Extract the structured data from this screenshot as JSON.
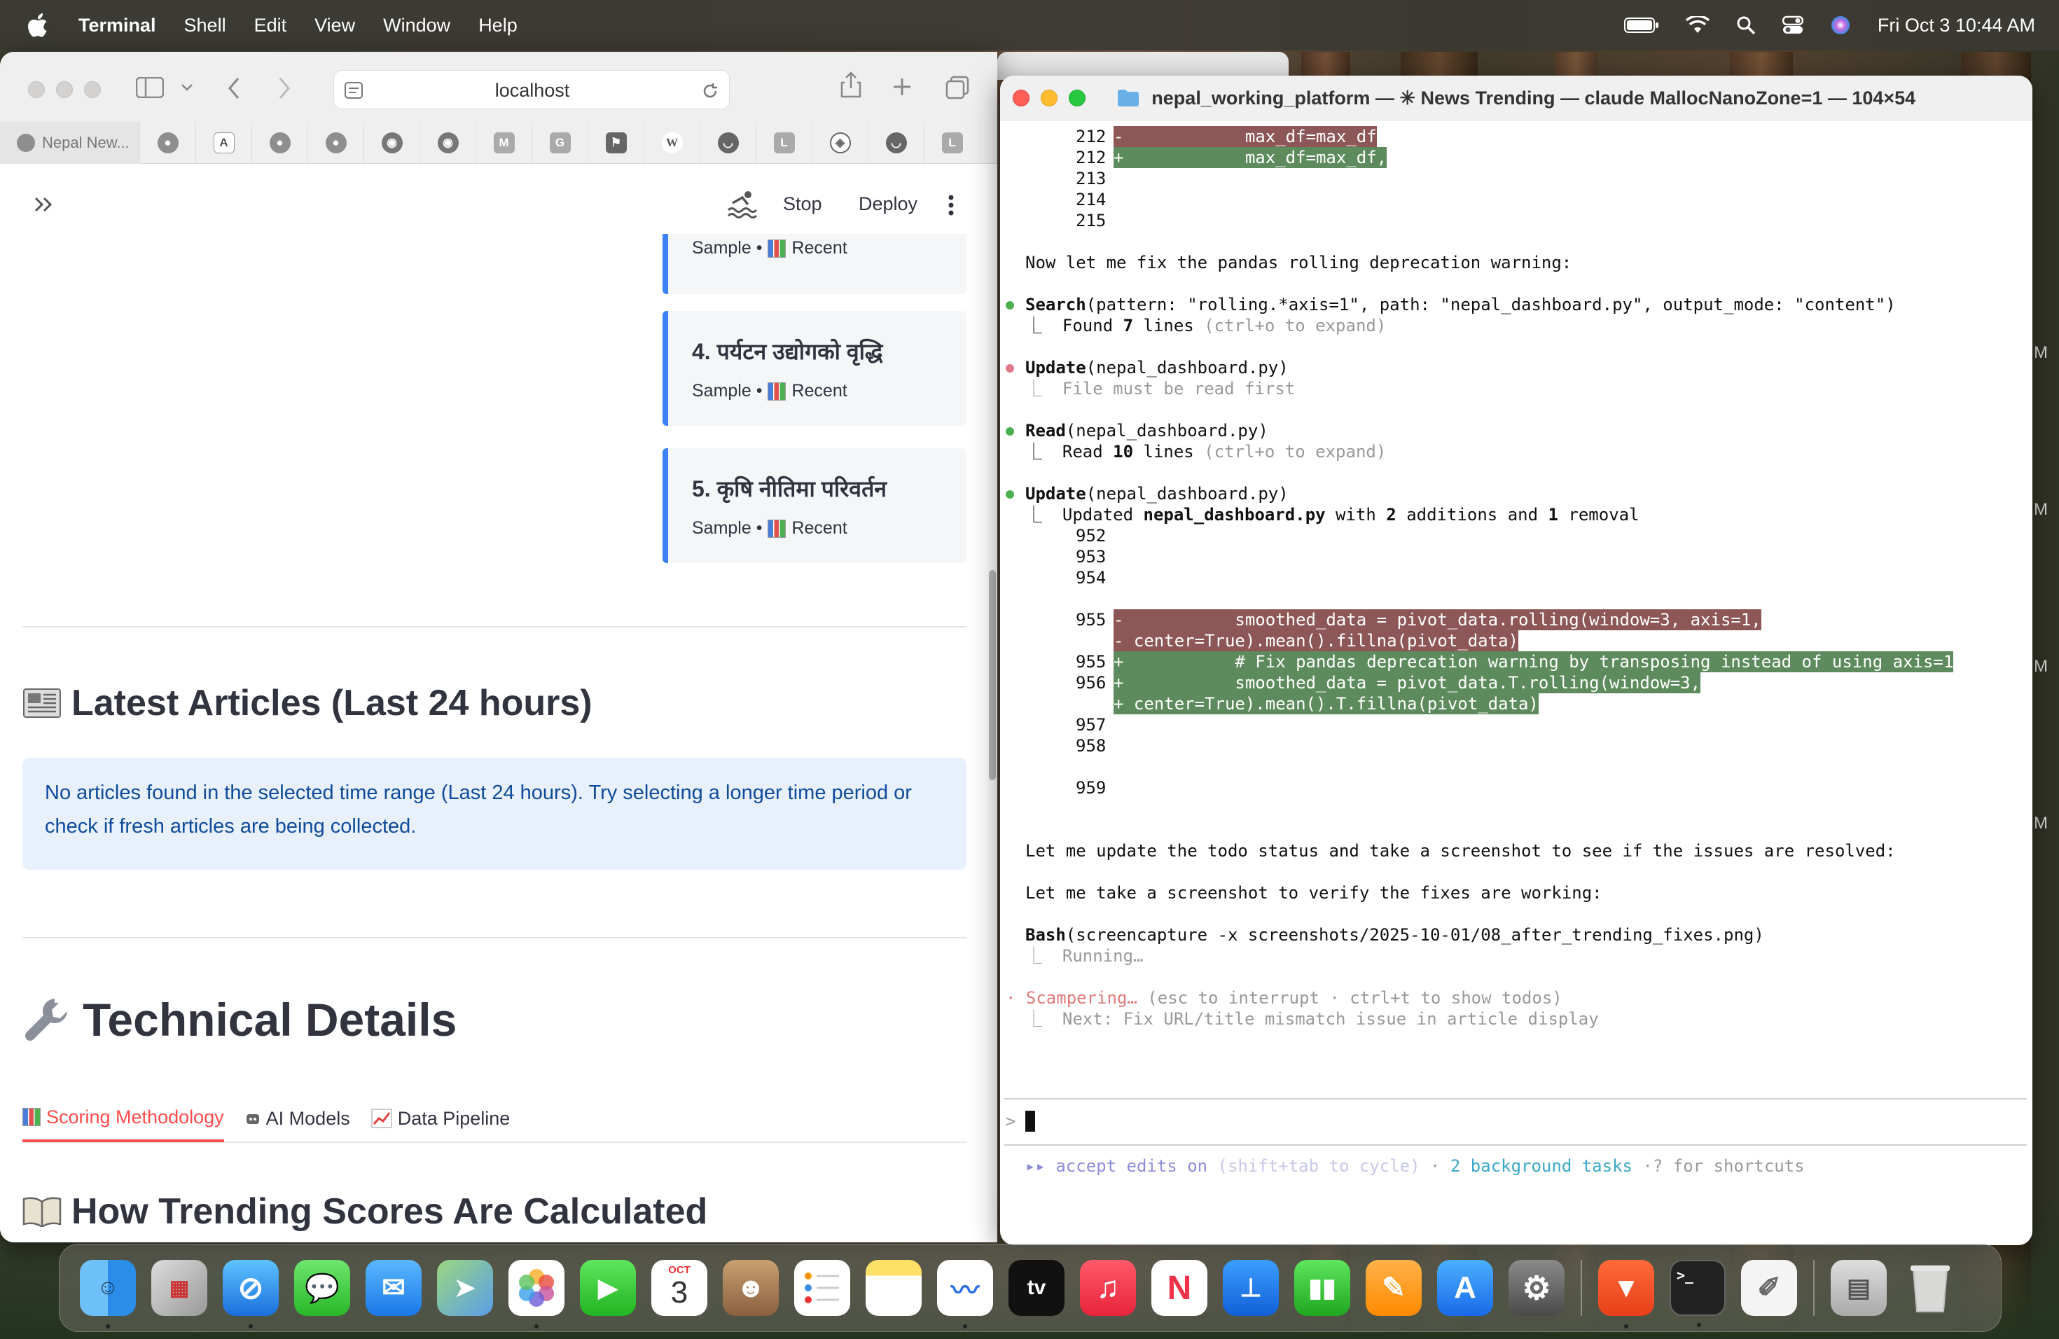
{
  "menubar": {
    "app_name": "Terminal",
    "items": [
      "Shell",
      "Edit",
      "View",
      "Window",
      "Help"
    ],
    "clock": "Fri Oct 3  10:44 AM"
  },
  "browser": {
    "url": "localhost",
    "active_tab": "Nepal New...",
    "tab_favicons": [
      "reddit-icon",
      "ai-icon",
      "reddit-icon",
      "reddit-icon",
      "github-icon",
      "github-icon",
      "M",
      "G",
      "flag-icon",
      "W",
      "pocket-icon",
      "L",
      "compass-icon",
      "pocket-icon",
      "L"
    ],
    "header": {
      "stop_label": "Stop",
      "deploy_label": "Deploy"
    },
    "cards": [
      {
        "title": "",
        "meta_prefix": "Sample •",
        "meta_suffix": "Recent"
      },
      {
        "title": "4. पर्यटन उद्योगको वृद्धि",
        "meta_prefix": "Sample •",
        "meta_suffix": "Recent"
      },
      {
        "title": "5. कृषि नीतिमा परिवर्तन",
        "meta_prefix": "Sample •",
        "meta_suffix": "Recent"
      }
    ],
    "latest_heading": "Latest Articles (Last 24 hours)",
    "info_text": "No articles found in the selected time range (Last 24 hours). Try selecting a longer time period or check if fresh articles are being collected.",
    "tech_heading": "Technical Details",
    "tabs": [
      "Scoring Methodology",
      "AI Models",
      "Data Pipeline"
    ],
    "how_heading": "How Trending Scores Are Calculated"
  },
  "terminal": {
    "title": "nepal_working_platform — ✳ News Trending — claude MallocNanoZone=1 — 104×54",
    "lines": {
      "l212a_num": "212",
      "l212a_code": "-            max_df=max_df",
      "l212b_num": "212",
      "l212b_code": "+            max_df=max_df,",
      "l213": "213",
      "l214": "214",
      "l215": "215",
      "msg1": "Now let me fix the pandas rolling deprecation warning:",
      "search_tool": "Search",
      "search_args": "(pattern: \"rolling.*axis=1\", path: \"nepal_dashboard.py\", output_mode: \"content\")",
      "search_res_a": "⎿  Found ",
      "search_res_n": "7",
      "search_res_b": " lines ",
      "search_res_hint": "(ctrl+o to expand)",
      "update1_tool": "Update",
      "update1_args": "(nepal_dashboard.py)",
      "update1_res": "⎿  File must be read first",
      "read_tool": "Read",
      "read_args": "(nepal_dashboard.py)",
      "read_res_a": "⎿  Read ",
      "read_res_n": "10",
      "read_res_b": " lines ",
      "read_res_hint": "(ctrl+o to expand)",
      "update2_tool": "Update",
      "update2_args": "(nepal_dashboard.py)",
      "update2_res_a": "⎿  Updated ",
      "update2_res_file": "nepal_dashboard.py",
      "update2_res_b": " with ",
      "update2_res_n1": "2",
      "update2_res_c": " additions and ",
      "update2_res_n2": "1",
      "update2_res_d": " removal",
      "n952": "952",
      "n953": "953",
      "n954": "954",
      "n955a": "955",
      "d955a": "-           smoothed_data = pivot_data.rolling(window=3, axis=1,",
      "d955b": "- center=True).mean().fillna(pivot_data)",
      "n955b": "955",
      "a955": "+           # Fix pandas deprecation warning by transposing instead of using axis=1",
      "n956": "956",
      "a956": "+           smoothed_data = pivot_data.T.rolling(window=3,",
      "a956b": "+ center=True).mean().T.fillna(pivot_data)",
      "n957": "957",
      "n958": "958",
      "n959": "959",
      "msg2": "Let me update the todo status and take a screenshot to see if the issues are resolved:",
      "msg3": "Let me take a screenshot to verify the fixes are working:",
      "bash_tool": "Bash",
      "bash_args": "(screencapture -x screenshots/2025-10-01/08_after_trending_fixes.png)",
      "bash_res": "⎿  Running…",
      "status_a": "· Scampering… ",
      "status_b": "(esc to interrupt · ctrl+t to show todos)",
      "next": "⎿  Next: Fix URL/title mismatch issue in article display",
      "prompt": ">",
      "footer_a": "▸▸ accept edits on ",
      "footer_b": "(shift+tab to cycle)",
      "footer_c": " · ",
      "footer_d": "2 background tasks",
      "footer_e": " ·? for shortcuts"
    },
    "colors": {
      "del_bg": "#8e5757",
      "add_bg": "#5d8b5d",
      "success_dot": "#4caf50",
      "error_dot": "#e07a8a",
      "status": "#e07a7a",
      "accent": "#8e8ed8",
      "bg_tasks": "#3aa8c8"
    }
  },
  "dock": {
    "calendar_month": "OCT",
    "calendar_day": "3",
    "tv_label": "tv"
  },
  "side_edge_letters": [
    "M",
    "M",
    "M",
    "M"
  ]
}
